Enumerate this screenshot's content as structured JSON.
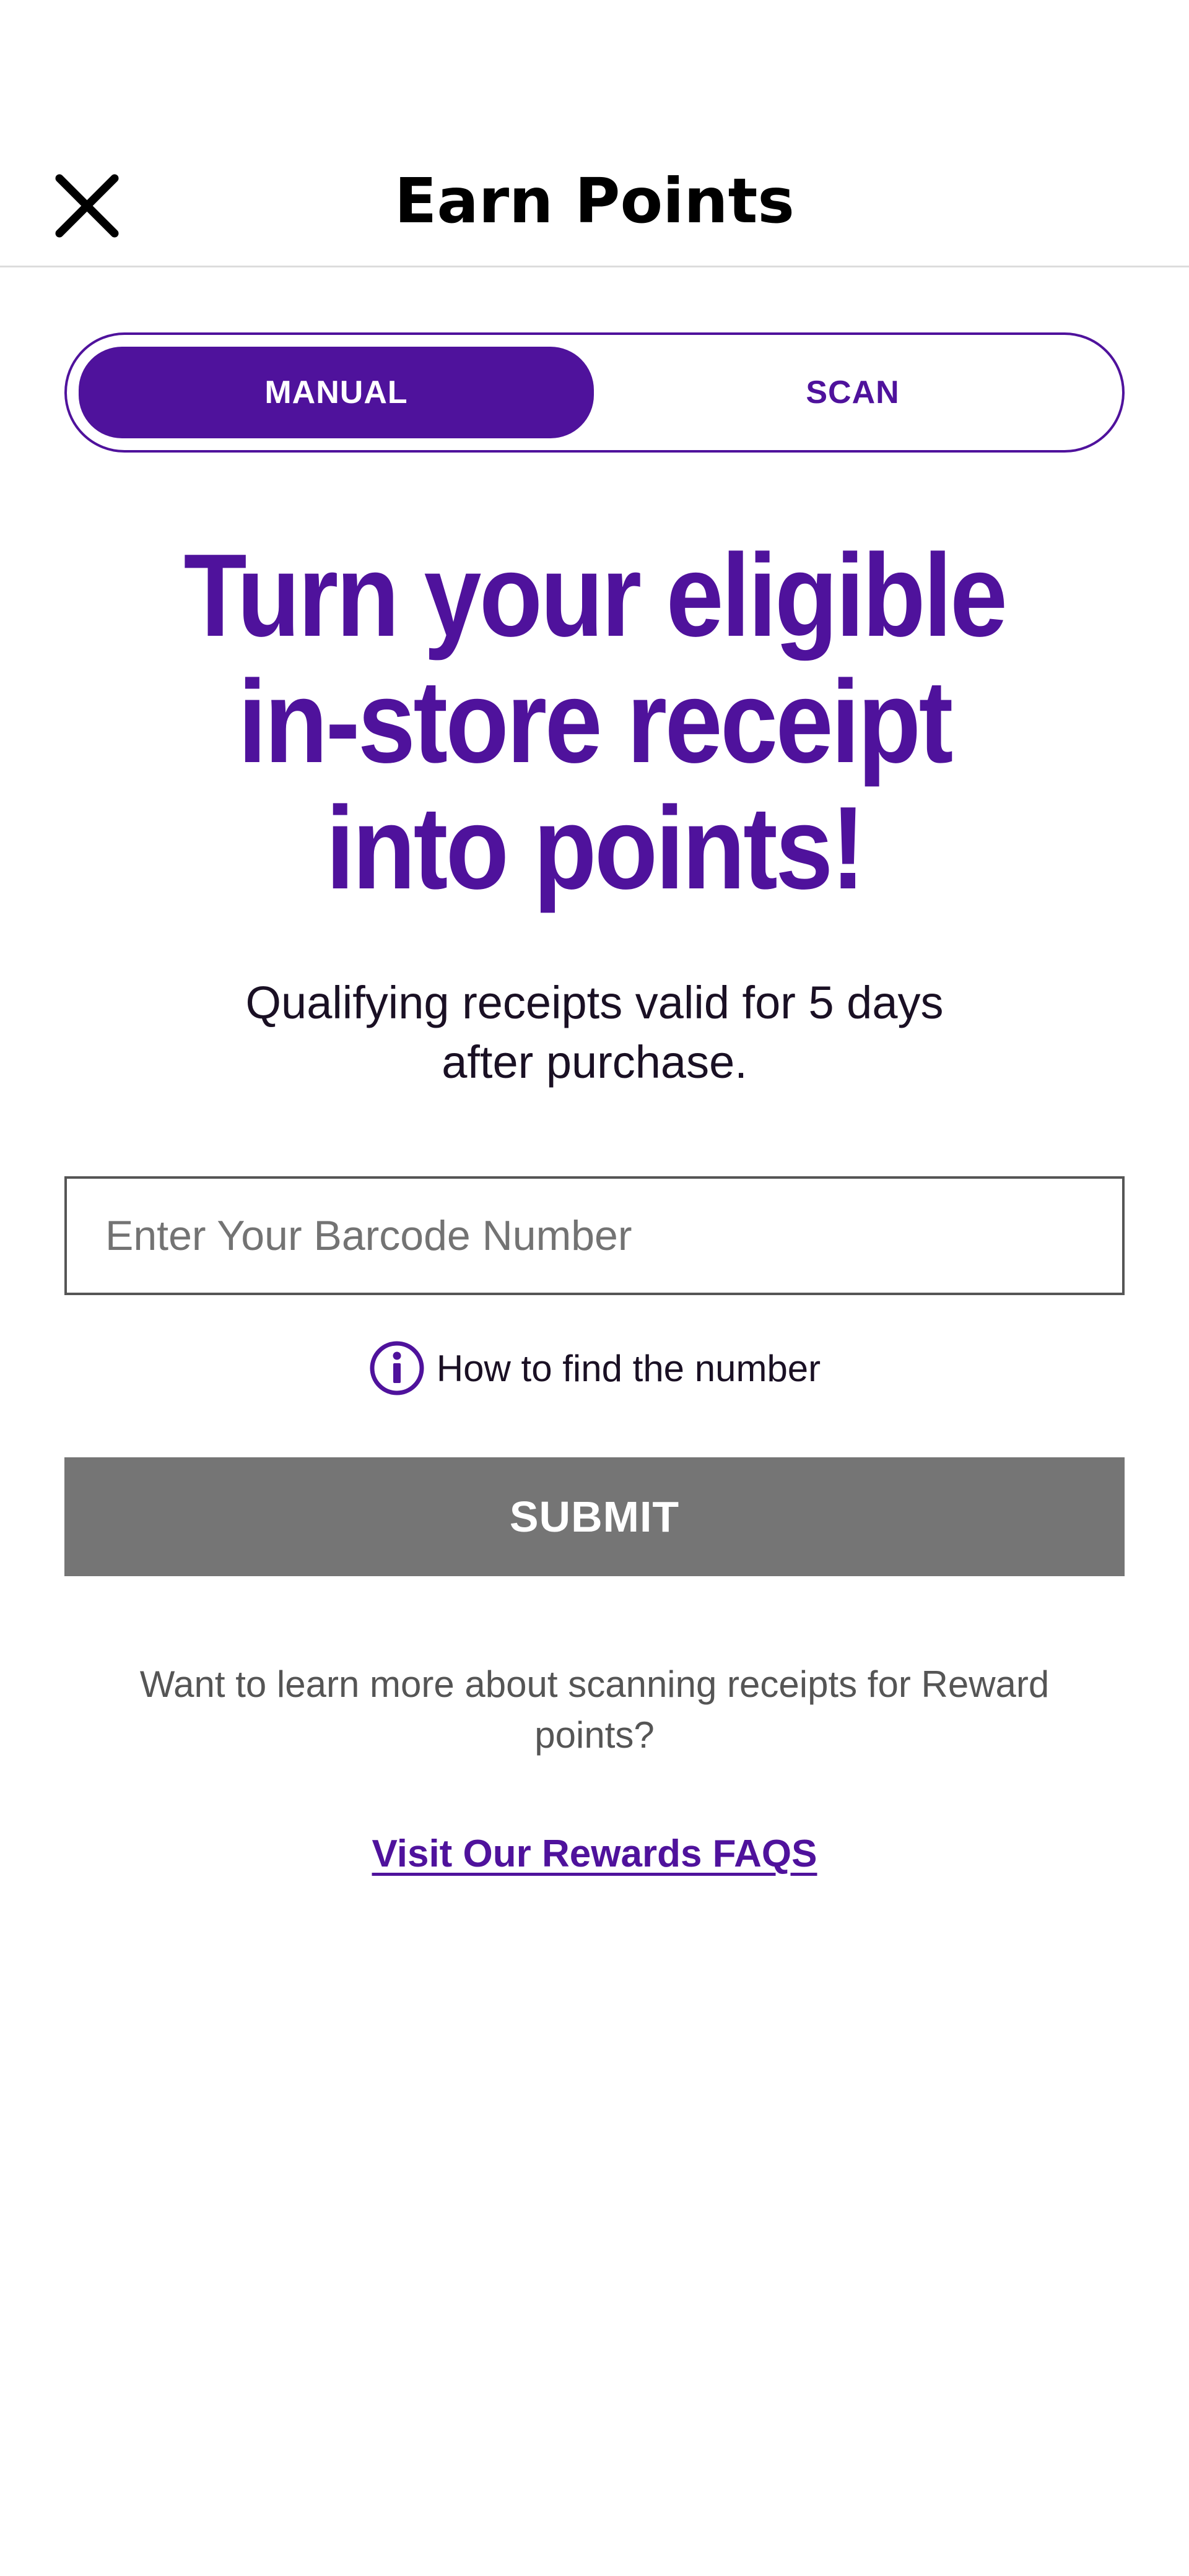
{
  "header": {
    "title": "Earn Points",
    "close_icon": "close-icon"
  },
  "mode_toggle": {
    "options": [
      {
        "label": "MANUAL",
        "selected": true
      },
      {
        "label": "SCAN",
        "selected": false
      }
    ]
  },
  "hero": {
    "lines": [
      "Turn your eligible",
      "in-store receipt",
      "into points!"
    ]
  },
  "subtitle": {
    "lines": [
      "Qualifying receipts valid for 5 days",
      "after purchase."
    ]
  },
  "barcode": {
    "placeholder": "Enter Your Barcode Number",
    "value": ""
  },
  "help": {
    "icon": "info-icon",
    "label": "How to find the number"
  },
  "submit": {
    "label": "SUBMIT",
    "enabled": false
  },
  "learn_more": {
    "text": "Want to learn more about scanning receipts for Reward points?"
  },
  "faq": {
    "label": "Visit Our Rewards FAQS"
  },
  "colors": {
    "brand_purple": "#4f129c",
    "disabled_gray": "#757575",
    "text_dark": "#1a1024",
    "text_muted": "#555555"
  }
}
